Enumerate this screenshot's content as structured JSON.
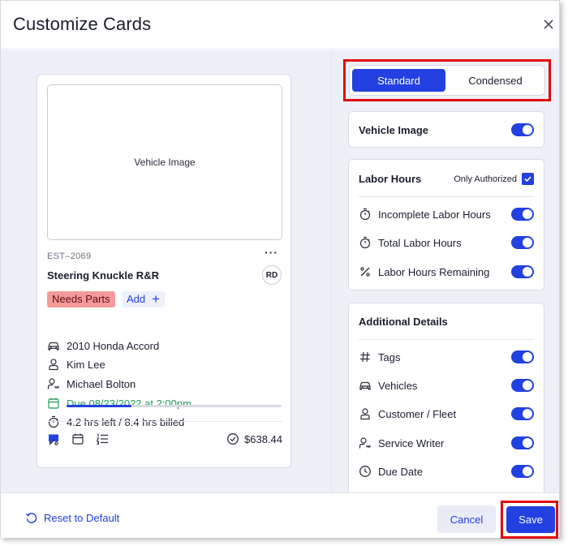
{
  "dialog": {
    "title": "Customize Cards"
  },
  "preview": {
    "image_placeholder": "Vehicle Image",
    "estimate_id": "EST–2069",
    "menu": "···",
    "job_title": "Steering Knuckle R&R",
    "assignee_initials": "RD",
    "tag": "Needs Parts",
    "add_tag_label": "Add",
    "add_tag_plus": "+",
    "vehicle": "2010 Honda Accord",
    "customer": "Kim Lee",
    "service_writer": "Michael Bolton",
    "due": "Due 08/23/2022 at 2:00pm",
    "hours": "4.2 hrs left / 8.4 hrs billed",
    "progress_percent": 30,
    "amount": "$638.44"
  },
  "view_toggle": {
    "standard": "Standard",
    "condensed": "Condensed",
    "selected": "Standard"
  },
  "vehicle_image_section": {
    "label": "Vehicle Image",
    "enabled": true
  },
  "labor_hours_section": {
    "label": "Labor Hours",
    "only_authorized_label": "Only Authorized",
    "only_authorized_checked": true,
    "items": [
      {
        "label": "Incomplete Labor Hours",
        "icon": "stopwatch-icon",
        "enabled": true
      },
      {
        "label": "Total Labor Hours",
        "icon": "stopwatch-icon",
        "enabled": true
      },
      {
        "label": "Labor Hours Remaining",
        "icon": "percent-icon",
        "enabled": true
      }
    ]
  },
  "additional_details_section": {
    "label": "Additional Details",
    "items": [
      {
        "label": "Tags",
        "icon": "hash-icon",
        "enabled": true
      },
      {
        "label": "Vehicles",
        "icon": "car-icon",
        "enabled": true
      },
      {
        "label": "Customer / Fleet",
        "icon": "person-icon",
        "enabled": true
      },
      {
        "label": "Service Writer",
        "icon": "person-key-icon",
        "enabled": true
      },
      {
        "label": "Due Date",
        "icon": "clock-icon",
        "enabled": true
      }
    ]
  },
  "footer": {
    "reset_label": "Reset to Default",
    "cancel_label": "Cancel",
    "save_label": "Save"
  },
  "colors": {
    "accent": "#2241e0",
    "highlight": "#e0080f",
    "tag_bg": "#f59a9a",
    "due_green": "#1e9a57"
  }
}
